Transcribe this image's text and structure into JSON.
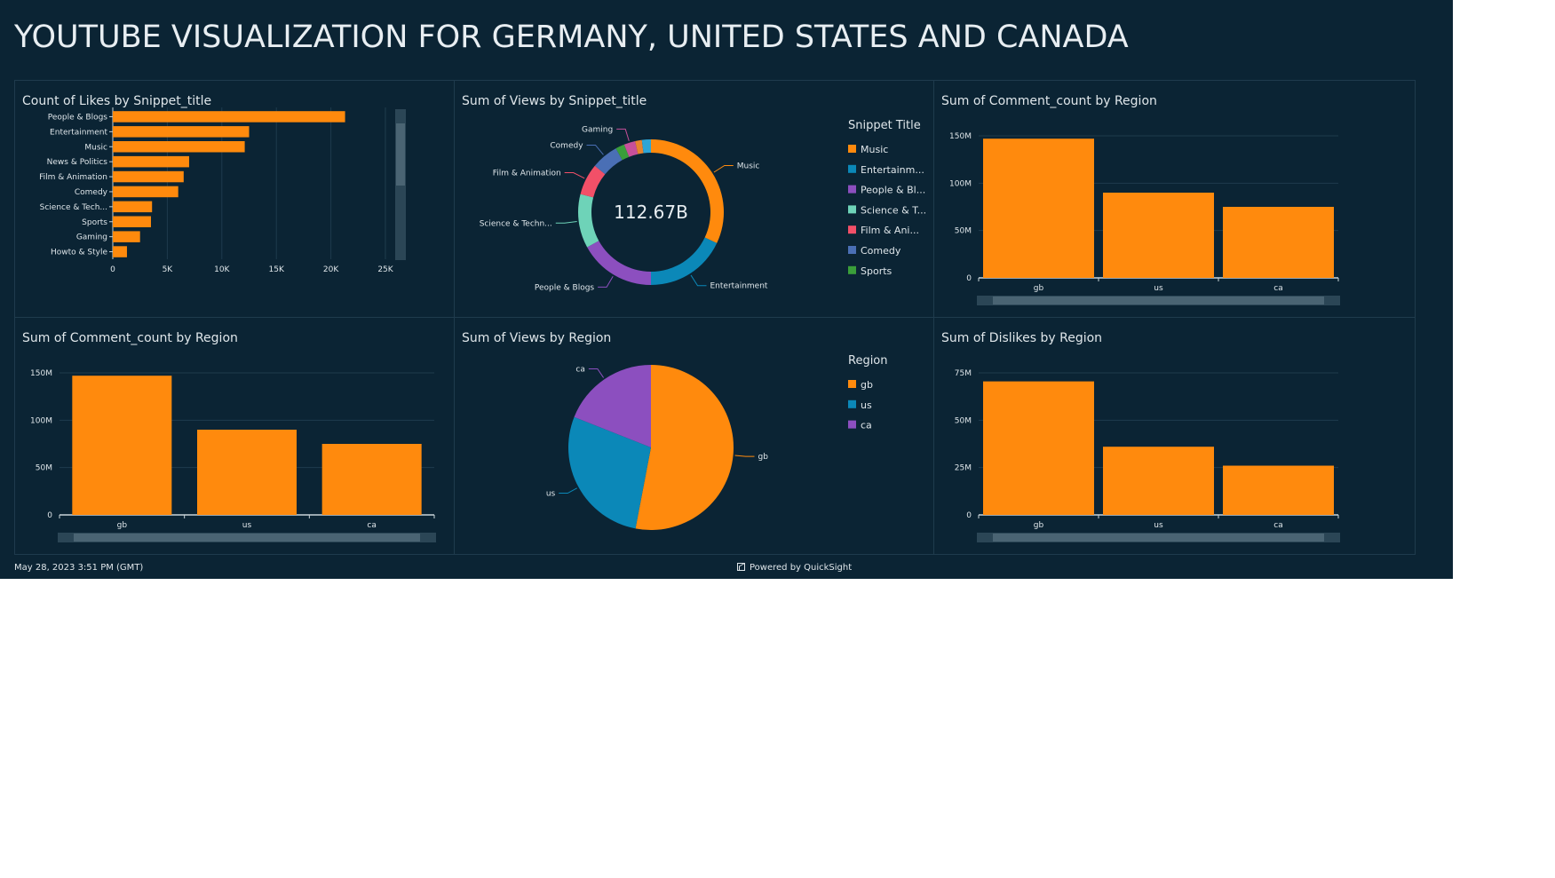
{
  "dashboard": {
    "title": "YOUTUBE VISUALIZATION FOR GERMANY, UNITED STATES AND CANADA",
    "footer_date": "May 28, 2023 3:51 PM (GMT)",
    "footer_powered": "Powered by QuickSight",
    "colors": {
      "background": "#0b2434",
      "bar": "#ff8a0d",
      "grid": "#1f3b4d",
      "text": "#dfe6ea"
    }
  },
  "chart_data": [
    {
      "id": "likes",
      "type": "bar",
      "orientation": "horizontal",
      "title": "Count of Likes by Snippet_title",
      "categories": [
        "People & Blogs",
        "Entertainment",
        "Music",
        "News & Politics",
        "Film & Animation",
        "Comedy",
        "Science & Tech...",
        "Sports",
        "Gaming",
        "Howto & Style"
      ],
      "values": [
        21300,
        12500,
        12100,
        7000,
        6500,
        6000,
        3600,
        3500,
        2500,
        1300
      ],
      "xlim": [
        0,
        25000
      ],
      "ticks": [
        0,
        5000,
        10000,
        15000,
        20000,
        25000
      ],
      "tick_labels": [
        "0",
        "5K",
        "10K",
        "15K",
        "20K",
        "25K"
      ],
      "color": "#ff8a0d",
      "grid": true
    },
    {
      "id": "views-snippet",
      "type": "pie",
      "donut": true,
      "title": "Sum of Views by Snippet_title",
      "center_label": "112.67B",
      "legend_title": "Snippet Title",
      "legend_position": "right",
      "legend_entries": [
        "Music",
        "Entertainm...",
        "People & Bl...",
        "Science & T...",
        "Film & Ani...",
        "Comedy",
        "Sports"
      ],
      "slices": [
        {
          "label": "Music",
          "value": 32,
          "color": "#ff8a0d"
        },
        {
          "label": "Entertainment",
          "value": 18,
          "color": "#0b88b8"
        },
        {
          "label": "People & Blogs",
          "value": 17,
          "color": "#8c4fbf"
        },
        {
          "label": "Science & Techn...",
          "value": 12,
          "color": "#6ed3b8"
        },
        {
          "label": "Film & Animation",
          "value": 7,
          "color": "#f25068"
        },
        {
          "label": "Comedy",
          "value": 6,
          "color": "#4a6fb5"
        },
        {
          "label": "",
          "value": 2,
          "color": "#3a9e3a"
        },
        {
          "label": "Gaming",
          "value": 2.5,
          "color": "#c8509a"
        },
        {
          "label": "",
          "value": 1.5,
          "color": "#e8842e"
        },
        {
          "label": "",
          "value": 2,
          "color": "#2ea5d6"
        }
      ]
    },
    {
      "id": "comments-top",
      "type": "bar",
      "title": "Sum of Comment_count by Region",
      "categories": [
        "gb",
        "us",
        "ca"
      ],
      "values": [
        147000000,
        90000000,
        75000000
      ],
      "ylim": [
        0,
        150000000
      ],
      "ticks": [
        0,
        50000000,
        100000000,
        150000000
      ],
      "tick_labels": [
        "0",
        "50M",
        "100M",
        "150M"
      ],
      "color": "#ff8a0d",
      "grid": true
    },
    {
      "id": "comments-bottom",
      "type": "bar",
      "title": "Sum of Comment_count by Region",
      "categories": [
        "gb",
        "us",
        "ca"
      ],
      "values": [
        147000000,
        90000000,
        75000000
      ],
      "ylim": [
        0,
        150000000
      ],
      "ticks": [
        0,
        50000000,
        100000000,
        150000000
      ],
      "tick_labels": [
        "0",
        "50M",
        "100M",
        "150M"
      ],
      "color": "#ff8a0d",
      "grid": true
    },
    {
      "id": "views-region",
      "type": "pie",
      "title": "Sum of Views by Region",
      "legend_title": "Region",
      "legend_position": "right",
      "legend_entries": [
        "gb",
        "us",
        "ca"
      ],
      "slices": [
        {
          "label": "gb",
          "value": 53,
          "color": "#ff8a0d"
        },
        {
          "label": "us",
          "value": 28,
          "color": "#0b88b8"
        },
        {
          "label": "ca",
          "value": 19,
          "color": "#8c4fbf"
        }
      ]
    },
    {
      "id": "dislikes",
      "type": "bar",
      "title": "Sum of Dislikes by Region",
      "categories": [
        "gb",
        "us",
        "ca"
      ],
      "values": [
        70500000,
        36000000,
        26000000
      ],
      "ylim": [
        0,
        75000000
      ],
      "ticks": [
        0,
        25000000,
        50000000,
        75000000
      ],
      "tick_labels": [
        "0",
        "25M",
        "50M",
        "75M"
      ],
      "color": "#ff8a0d",
      "grid": true
    }
  ]
}
